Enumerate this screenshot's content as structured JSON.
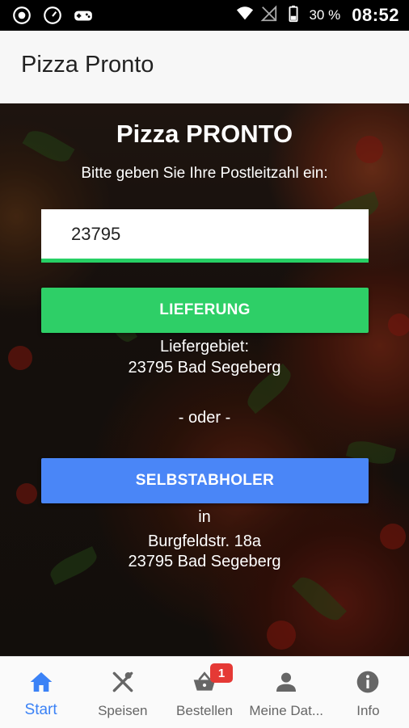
{
  "status_bar": {
    "battery_percent": "30 %",
    "time": "08:52"
  },
  "app_bar": {
    "title": "Pizza Pronto"
  },
  "main": {
    "heading": "Pizza PRONTO",
    "prompt": "Bitte geben Sie Ihre Postleitzahl ein:",
    "zip_value": "23795",
    "delivery_button": "LIEFERUNG",
    "delivery_area_label": "Liefergebiet:",
    "delivery_area_value": "23795 Bad Segeberg",
    "or_text": "- oder -",
    "pickup_button": "SELBSTABHOLER",
    "in_text": "in",
    "pickup_street": "Burgfeldstr. 18a",
    "pickup_city": "23795 Bad Segeberg"
  },
  "bottom_nav": {
    "items": [
      {
        "label": "Start",
        "icon": "home-icon",
        "active": true
      },
      {
        "label": "Speisen",
        "icon": "utensils-icon"
      },
      {
        "label": "Bestellen",
        "icon": "basket-icon",
        "badge": "1"
      },
      {
        "label": "Meine Dat...",
        "icon": "user-icon"
      },
      {
        "label": "Info",
        "icon": "info-icon"
      }
    ]
  },
  "colors": {
    "accent_green": "#2ecf67",
    "accent_blue": "#4a86f7",
    "nav_active": "#3b82f6",
    "badge_red": "#e53935"
  }
}
